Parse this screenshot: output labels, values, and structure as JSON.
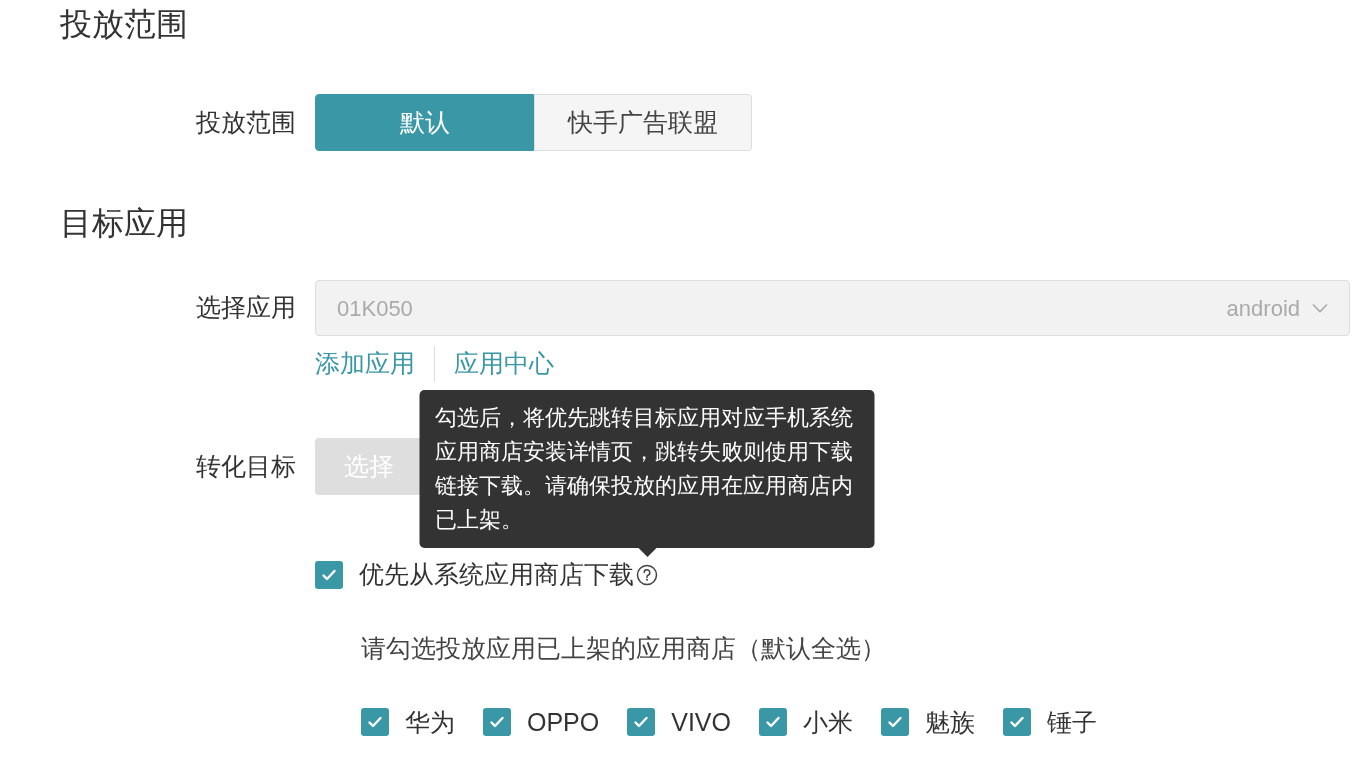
{
  "sections": [
    {
      "title": "投放范围"
    },
    {
      "title": "目标应用"
    }
  ],
  "scope": {
    "label": "投放范围",
    "options": [
      {
        "label": "默认",
        "selected": true
      },
      {
        "label": "快手广告联盟",
        "selected": false
      }
    ]
  },
  "app_select": {
    "label": "选择应用",
    "value": "01K050",
    "platform": "android",
    "disabled": true
  },
  "app_links": [
    "添加应用",
    "应用中心"
  ],
  "conversion": {
    "label": "转化目标",
    "button": "选择",
    "disabled": true
  },
  "prefer_store": {
    "label": "优先从系统应用商店下载",
    "checked": true,
    "tooltip": "勾选后，将优先跳转目标应用对应手机系统应用商店安装详情页，跳转失败则使用下载链接下载。请确保投放的应用在应用商店内已上架。"
  },
  "stores_hint": "请勾选投放应用已上架的应用商店（默认全选）",
  "stores": [
    {
      "label": "华为",
      "checked": true
    },
    {
      "label": "OPPO",
      "checked": true
    },
    {
      "label": "VIVO",
      "checked": true
    },
    {
      "label": "小米",
      "checked": true
    },
    {
      "label": "魅族",
      "checked": true
    },
    {
      "label": "锤子",
      "checked": true
    }
  ]
}
